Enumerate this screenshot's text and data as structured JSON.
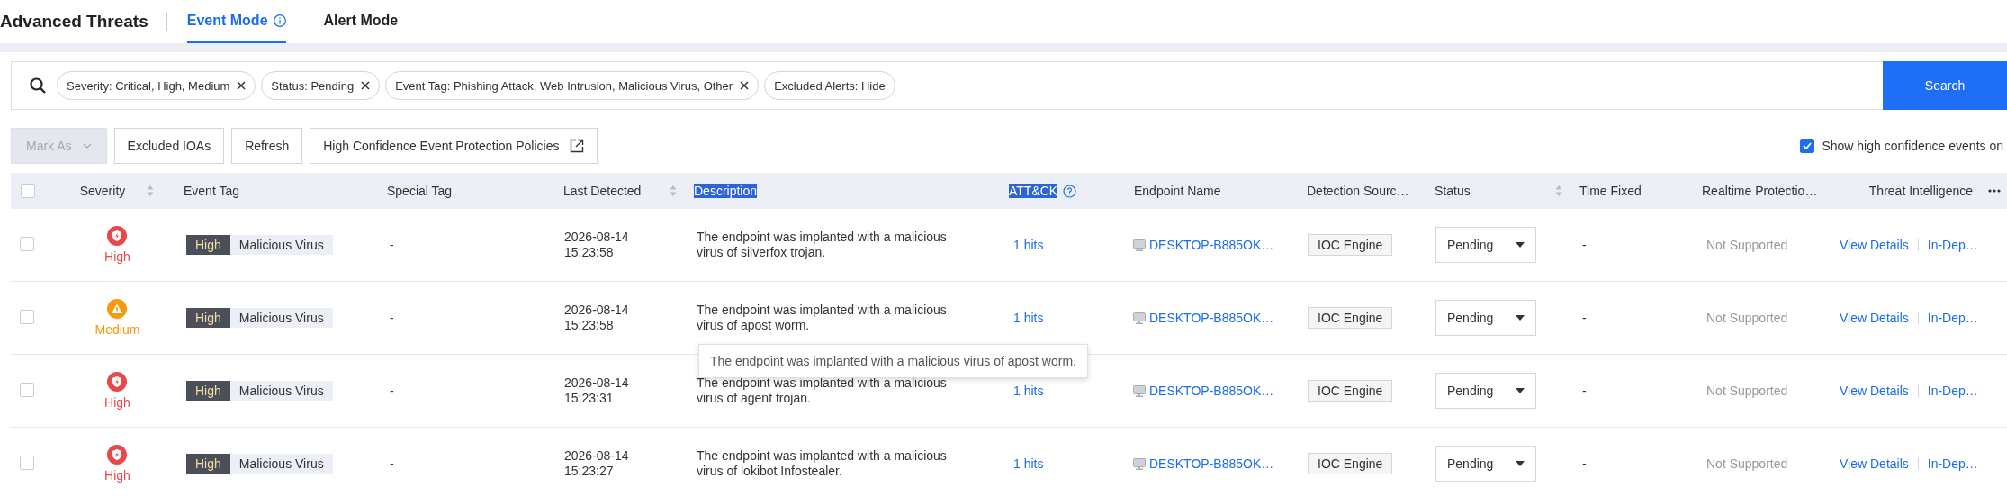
{
  "header": {
    "title": "Advanced Threats",
    "tabs": [
      {
        "label": "Event Mode",
        "selected": true,
        "info": true
      },
      {
        "label": "Alert Mode",
        "selected": false,
        "info": false
      }
    ]
  },
  "filters": {
    "chips": [
      {
        "label": "Severity: Critical, High, Medium",
        "removable": true
      },
      {
        "label": "Status: Pending",
        "removable": true
      },
      {
        "label": "Event Tag: Phishing Attack, Web Intrusion, Malicious Virus, Other",
        "removable": true
      },
      {
        "label": "Excluded Alerts: Hide",
        "removable": false
      }
    ],
    "search_button": "Search"
  },
  "toolbar": {
    "buttons": [
      {
        "label": "Mark As",
        "kind": "dropdown",
        "disabled": true
      },
      {
        "label": "Excluded IOAs",
        "kind": "plain",
        "disabled": false
      },
      {
        "label": "Refresh",
        "kind": "plain",
        "disabled": false
      },
      {
        "label": "High Confidence Event Protection Policies",
        "kind": "external",
        "disabled": false
      }
    ],
    "option": {
      "label": "Show high confidence events on",
      "checked": true
    }
  },
  "table": {
    "all_selected": false,
    "columns": [
      {
        "label": "Severity",
        "kind": "sortable",
        "highlighted": false
      },
      {
        "label": "Event Tag",
        "kind": "plain",
        "highlighted": false
      },
      {
        "label": "Special Tag",
        "kind": "plain",
        "highlighted": false
      },
      {
        "label": "Last Detected",
        "kind": "sortable",
        "highlighted": false
      },
      {
        "label": "Description",
        "kind": "plain",
        "highlighted": true
      },
      {
        "label": "ATT&CK",
        "kind": "help",
        "highlighted": true
      },
      {
        "label": "Endpoint Name",
        "kind": "plain",
        "highlighted": false
      },
      {
        "label": "Detection Sourc…",
        "kind": "plain",
        "highlighted": false
      },
      {
        "label": "Status",
        "kind": "sortable",
        "highlighted": false
      },
      {
        "label": "Time Fixed",
        "kind": "plain",
        "highlighted": false
      },
      {
        "label": "Realtime Protectio…",
        "kind": "plain",
        "highlighted": false
      },
      {
        "label": "Threat Intelligence",
        "kind": "plain",
        "highlighted": false
      }
    ],
    "rows": [
      {
        "selected": false,
        "severity": {
          "kind": "high",
          "label": "High"
        },
        "level_tag": "High",
        "event_tag": "Malicious Virus",
        "special_tag": "-",
        "last_detected": "2026-08-14 15:23:58",
        "description": "The endpoint was implanted with a malicious virus of silverfox trojan.",
        "attck": "1 hits",
        "endpoint": "DESKTOP-B885OK…",
        "source": "IOC Engine",
        "status": "Pending",
        "time_fixed": "-",
        "realtime": "Not Supported",
        "actions": [
          "View Details",
          "In-Dep…"
        ]
      },
      {
        "selected": false,
        "severity": {
          "kind": "medium",
          "label": "Medium"
        },
        "level_tag": "High",
        "event_tag": "Malicious Virus",
        "special_tag": "-",
        "last_detected": "2026-08-14 15:23:58",
        "description": "The endpoint was implanted with a malicious virus of apost worm.",
        "attck": "1 hits",
        "endpoint": "DESKTOP-B885OK…",
        "source": "IOC Engine",
        "status": "Pending",
        "time_fixed": "-",
        "realtime": "Not Supported",
        "actions": [
          "View Details",
          "In-Dep…"
        ]
      },
      {
        "selected": false,
        "severity": {
          "kind": "high",
          "label": "High"
        },
        "level_tag": "High",
        "event_tag": "Malicious Virus",
        "special_tag": "-",
        "last_detected": "2026-08-14 15:23:31",
        "description": "The endpoint was implanted with a malicious virus of agent trojan.",
        "attck": "1 hits",
        "endpoint": "DESKTOP-B885OK…",
        "source": "IOC Engine",
        "status": "Pending",
        "time_fixed": "-",
        "realtime": "Not Supported",
        "actions": [
          "View Details",
          "In-Dep…"
        ]
      },
      {
        "selected": false,
        "severity": {
          "kind": "high",
          "label": "High"
        },
        "level_tag": "High",
        "event_tag": "Malicious Virus",
        "special_tag": "-",
        "last_detected": "2026-08-14 15:23:27",
        "description": "The endpoint was implanted with a malicious virus of lokibot Infostealer.",
        "attck": "1 hits",
        "endpoint": "DESKTOP-B885OK…",
        "source": "IOC Engine",
        "status": "Pending",
        "time_fixed": "-",
        "realtime": "Not Supported",
        "actions": [
          "View Details",
          "In-Dep…"
        ]
      }
    ],
    "tooltip": "The endpoint was implanted with a malicious virus of apost worm."
  }
}
